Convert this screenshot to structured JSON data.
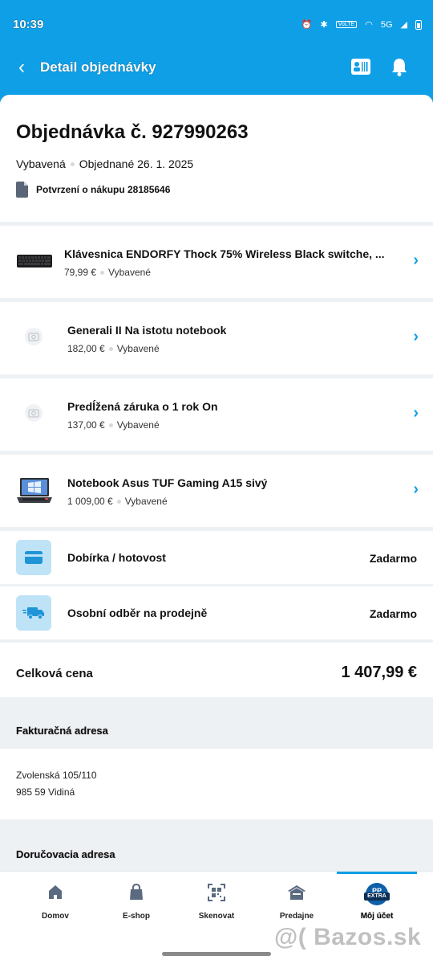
{
  "status_bar": {
    "time": "10:39",
    "network": "5G",
    "volte": "VoLTE"
  },
  "app_bar": {
    "title": "Detail objednávky"
  },
  "order": {
    "title": "Objednávka č. 927990263",
    "status": "Vybavená",
    "ordered": "Objednané 26. 1. 2025",
    "receipt": "Potvrzení o nákupu 28185646"
  },
  "items": [
    {
      "name": "Klávesnica ENDORFY Thock 75% Wireless Black switche, ...",
      "price": "79,99 €",
      "status": "Vybavené",
      "thumb": "keyboard-thumbnail"
    },
    {
      "name": "Generali II Na istotu notebook",
      "price": "182,00 €",
      "status": "Vybavené",
      "thumb": "placeholder-image-icon"
    },
    {
      "name": "Predĺžená záruka o 1 rok On",
      "price": "137,00 €",
      "status": "Vybavené",
      "thumb": "placeholder-image-icon"
    },
    {
      "name": "Notebook Asus TUF Gaming A15 sivý",
      "price": "1 009,00 €",
      "status": "Vybavené",
      "thumb": "laptop-thumbnail"
    }
  ],
  "payment": {
    "label": "Dobírka / hotovost",
    "price": "Zadarmo",
    "icon": "credit-card-icon"
  },
  "delivery": {
    "label": "Osobní odběr na prodejně",
    "price": "Zadarmo",
    "icon": "delivery-truck-icon"
  },
  "total": {
    "label": "Celková cena",
    "value": "1 407,99 €"
  },
  "billing": {
    "header": "Fakturačná adresa",
    "line1": "Zvolenská 105/110",
    "line2": "985 59 Vidiná"
  },
  "shipping": {
    "header": "Doručovacia adresa"
  },
  "bottom_nav": [
    {
      "label": "Domov",
      "icon": "home-icon"
    },
    {
      "label": "E-shop",
      "icon": "shopping-bag-icon"
    },
    {
      "label": "Skenovat",
      "icon": "qr-scan-icon"
    },
    {
      "label": "Predajne",
      "icon": "store-icon"
    },
    {
      "label": "Môj účet",
      "icon": "pp-extra-badge",
      "badge_top": "PP",
      "badge_bottom": "EXTRA",
      "active": true
    }
  ],
  "watermark": "@( Bazos.sk",
  "colors": {
    "accent": "#0f9fe6",
    "icon_bg": "#bfe3f6",
    "background": "#eef1f4"
  }
}
